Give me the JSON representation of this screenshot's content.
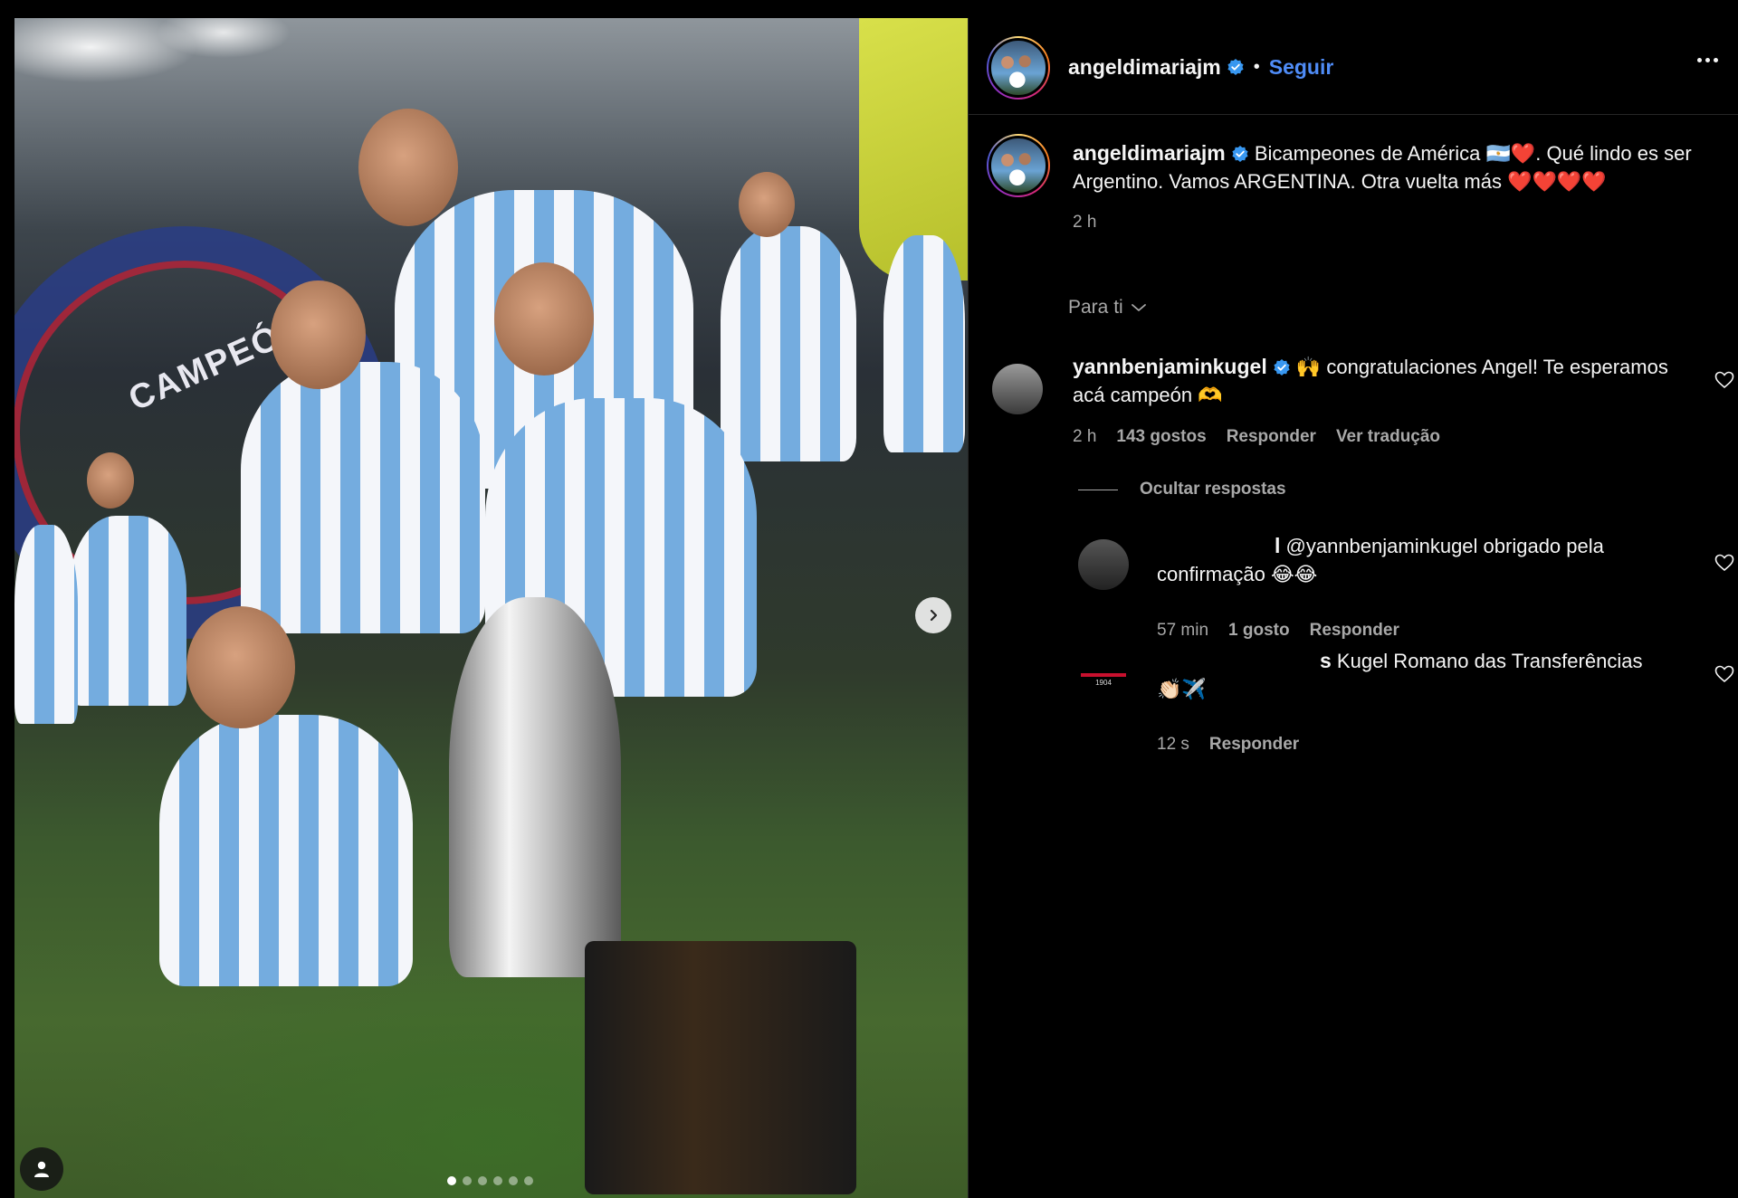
{
  "post": {
    "author": "angeldimariajm",
    "follow_label": "Seguir",
    "separator": "•",
    "caption_line": "Bicampeones de América 🇦🇷❤️. Qué lindo es ser Argentino. Vamos ARGENTINA. Otra vuelta más ❤️❤️❤️❤️",
    "time": "2 h",
    "media_banner_text": "CAMPEÓN",
    "carousel": {
      "count": 6,
      "active_index": 0
    }
  },
  "sort": {
    "label": "Para ti"
  },
  "comments": [
    {
      "username": "yannbenjaminkugel",
      "text": "🙌 congratulaciones Angel! Te esperamos acá campeón 🫶",
      "time": "2 h",
      "likes": "143 gostos",
      "reply_label": "Responder",
      "translate_label": "Ver tradução"
    }
  ],
  "hide_replies_label": "Ocultar respostas",
  "replies": [
    {
      "username_visible": "l",
      "text": "@yannbenjaminkugel obrigado pela confirmação 😂😂",
      "time": "57 min",
      "likes": "1 gosto",
      "reply_label": "Responder"
    },
    {
      "username_visible": "s",
      "text": "Kugel Romano das Transferências",
      "text_line2": "👏🏻✈️",
      "avatar_text": "1904",
      "time": "12 s",
      "reply_label": "Responder"
    }
  ],
  "colors": {
    "link": "#4f8cf7",
    "muted": "#a8a8a8",
    "verified": "#3897f0",
    "jersey_blue": "#74acdf"
  }
}
